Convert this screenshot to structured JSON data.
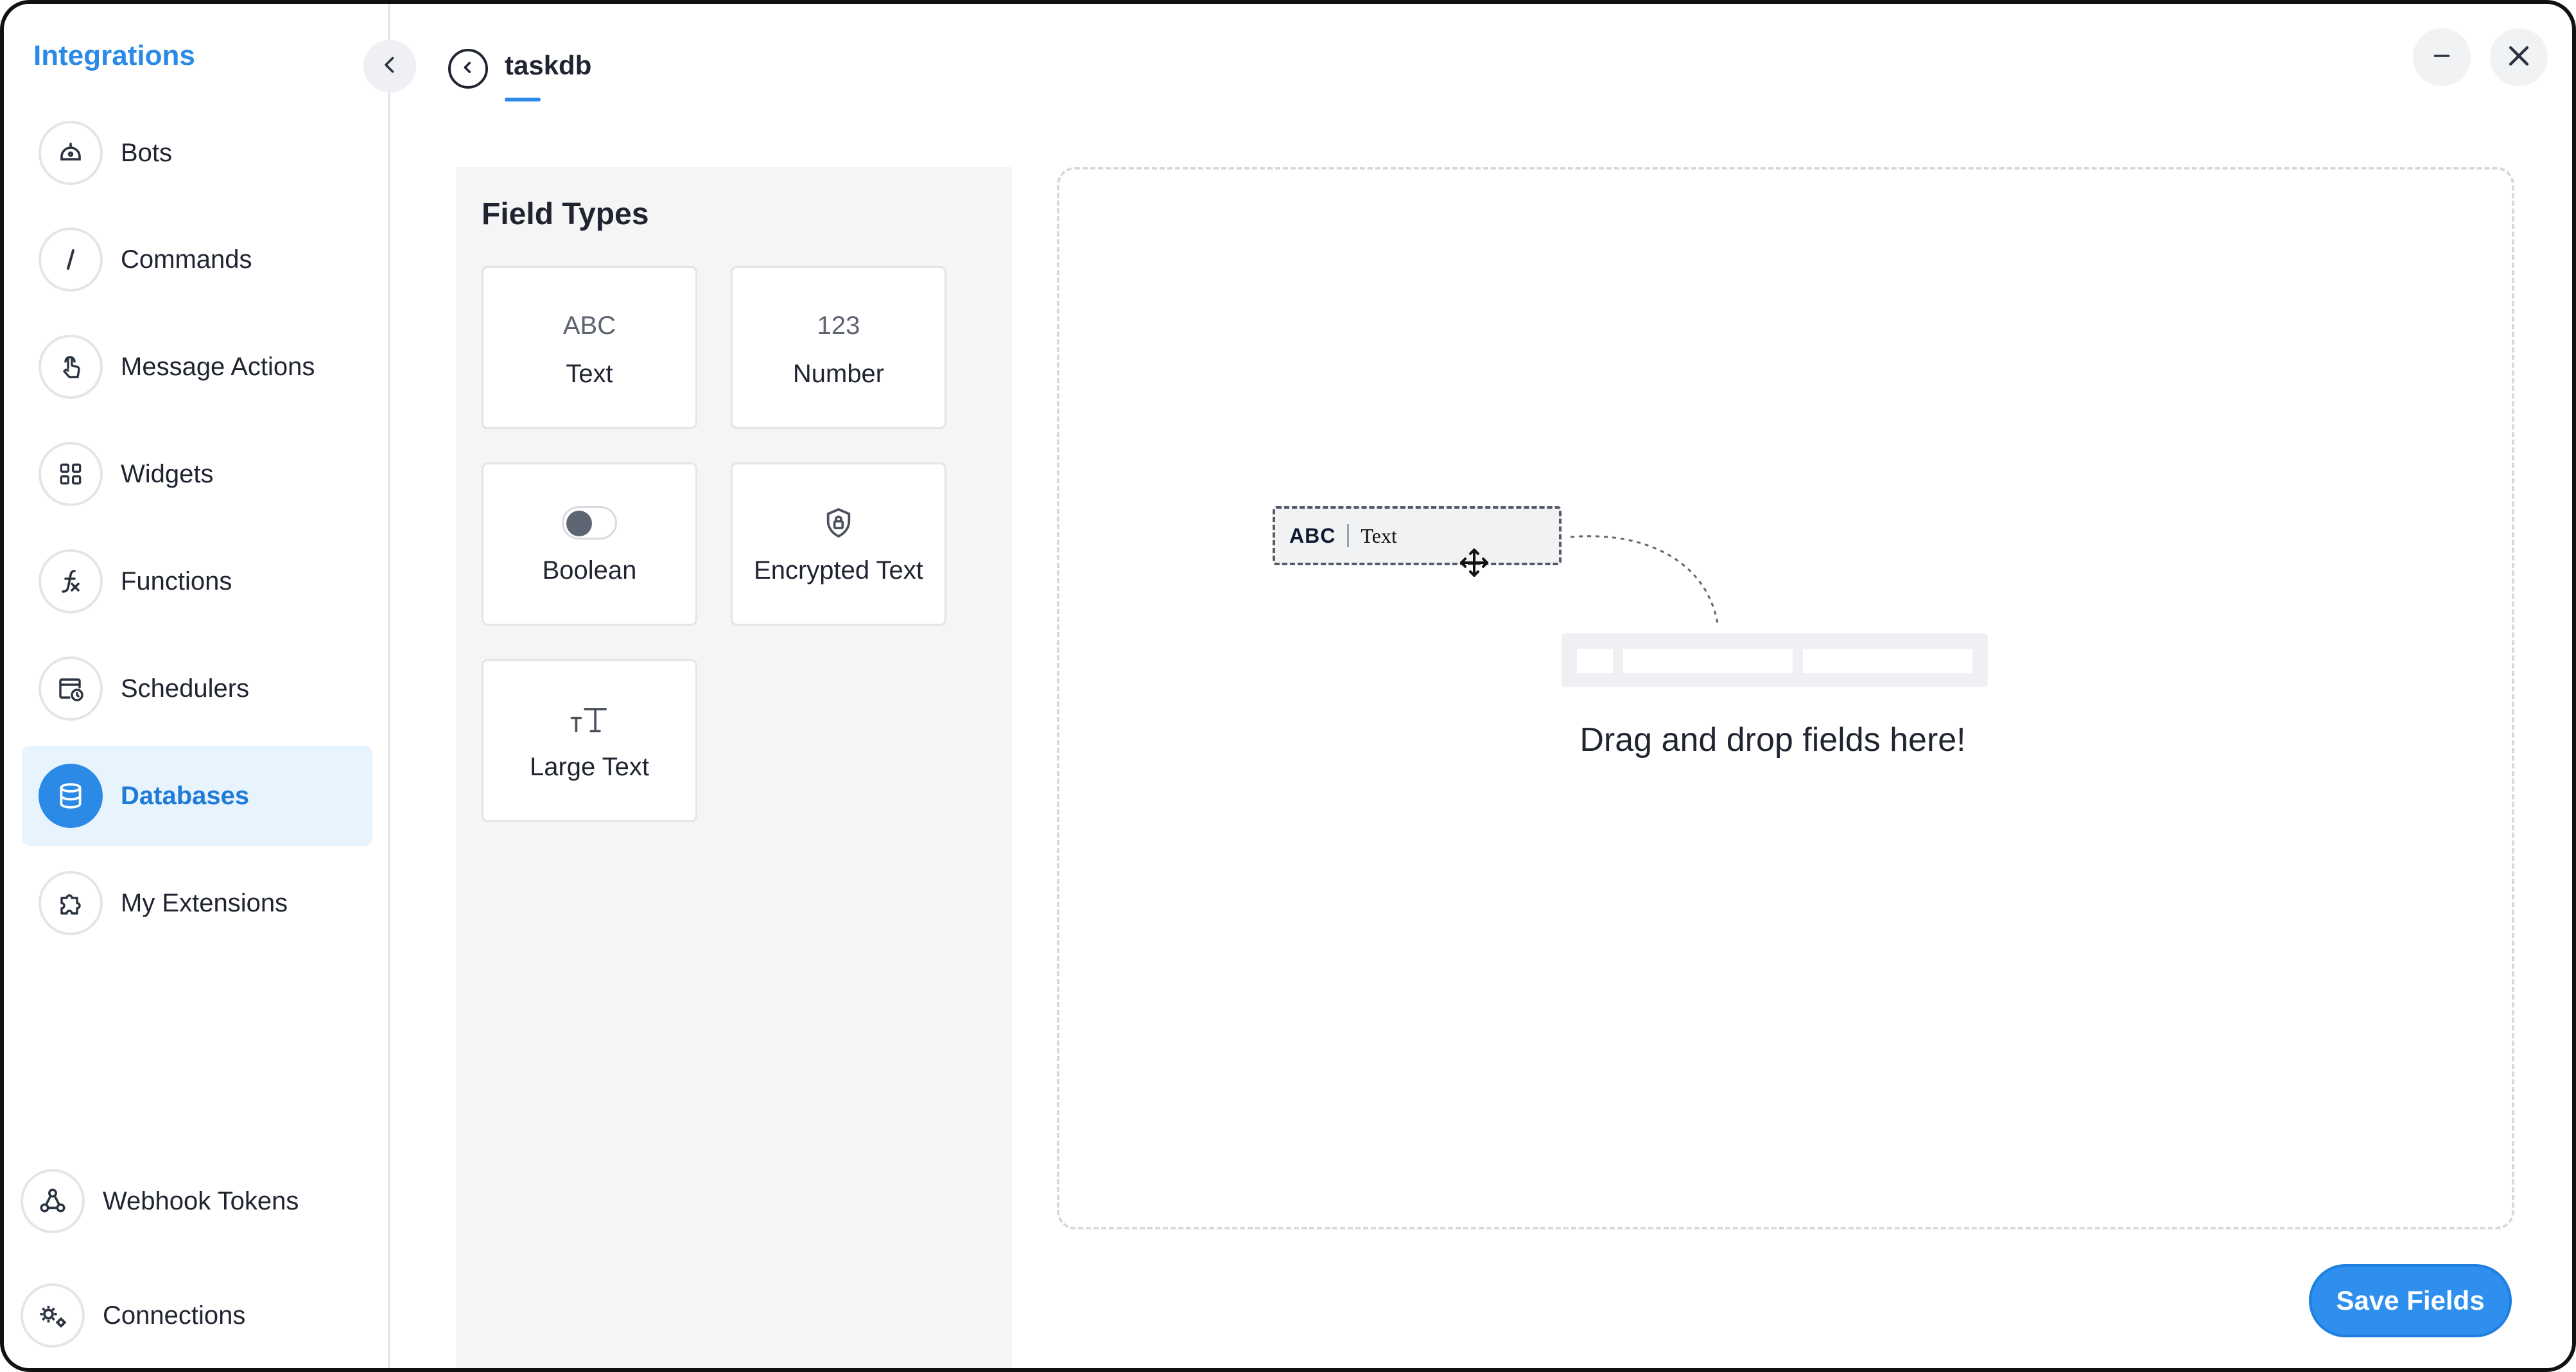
{
  "sidebar": {
    "title": "Integrations",
    "items": [
      {
        "label": "Bots",
        "icon": "bot-icon",
        "active": false
      },
      {
        "label": "Commands",
        "icon": "slash-icon",
        "active": false
      },
      {
        "label": "Message Actions",
        "icon": "pointer-hand-icon",
        "active": false
      },
      {
        "label": "Widgets",
        "icon": "grid-icon",
        "active": false
      },
      {
        "label": "Functions",
        "icon": "function-icon",
        "active": false
      },
      {
        "label": "Schedulers",
        "icon": "calendar-clock-icon",
        "active": false
      },
      {
        "label": "Databases",
        "icon": "database-icon",
        "active": true
      },
      {
        "label": "My Extensions",
        "icon": "puzzle-icon",
        "active": false
      }
    ],
    "bottom_items": [
      {
        "label": "Webhook Tokens",
        "icon": "webhook-icon"
      },
      {
        "label": "Connections",
        "icon": "gears-icon"
      }
    ]
  },
  "header": {
    "title": "taskdb"
  },
  "field_types": {
    "title": "Field Types",
    "types": [
      {
        "glyph": "ABC",
        "label": "Text"
      },
      {
        "glyph": "123",
        "label": "Number"
      },
      {
        "glyph": "",
        "label": "Boolean",
        "icon": "toggle-icon"
      },
      {
        "glyph": "",
        "label": "Encrypted Text",
        "icon": "shield-lock-icon"
      },
      {
        "glyph": "",
        "label": "Large Text",
        "icon": "text-size-icon"
      }
    ]
  },
  "drop_zone": {
    "chip_glyph": "ABC",
    "chip_label": "Text",
    "hint": "Drag and drop fields here!"
  },
  "actions": {
    "save_label": "Save Fields"
  },
  "colors": {
    "accent": "#2a8ae5",
    "active_bg": "#e7f3fd",
    "panel_bg": "#f5f5f6"
  }
}
